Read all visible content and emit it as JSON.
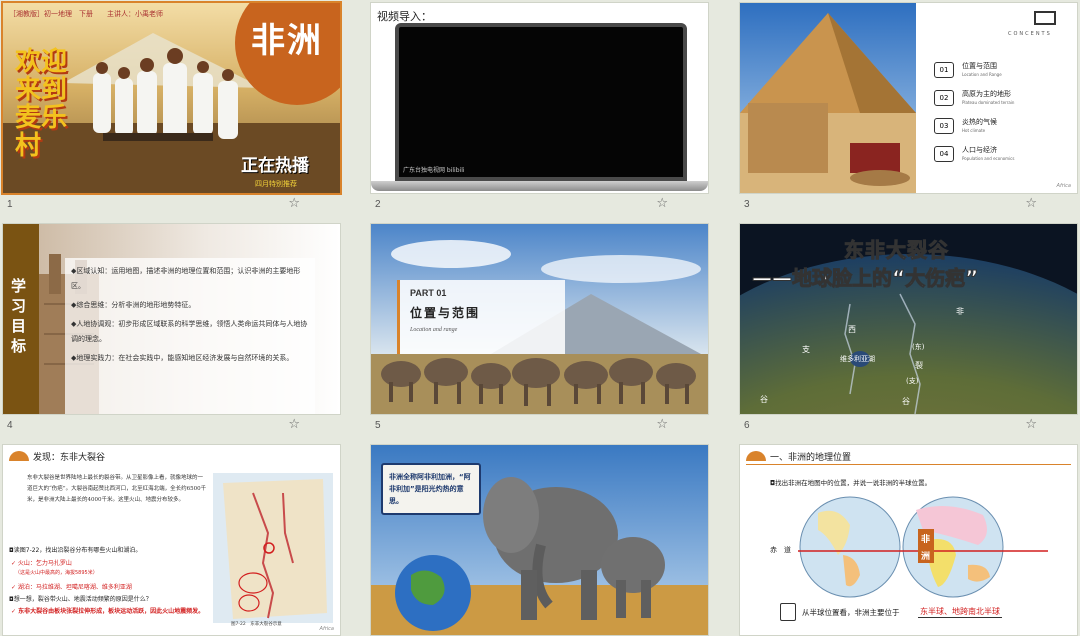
{
  "slides": [
    {
      "number": "1",
      "header": "［湘教版］初一地理　下册　　主讲人：小禹老师",
      "title_big": "非洲",
      "movie_title": "欢迎来到麦乐村",
      "badge": "正在热播",
      "bottom_text": "四月特别推荐"
    },
    {
      "number": "2",
      "label": "视频导入：",
      "watermark": "广东台独电视网 bilibili"
    },
    {
      "number": "3",
      "contents_word": "CONCENTS",
      "footer": "Africa",
      "items": [
        {
          "no": "01",
          "cn": "位置与范围",
          "en": "Location and Range"
        },
        {
          "no": "02",
          "cn": "高原为主的地形",
          "en": "Plateau dominated terrain"
        },
        {
          "no": "03",
          "cn": "炎热的气候",
          "en": "Hot climate"
        },
        {
          "no": "04",
          "cn": "人口与经济",
          "en": "Population and economics"
        }
      ]
    },
    {
      "number": "4",
      "side_title": "学习目标",
      "points": [
        "◆区域认知：运用地图，描述非洲的地理位置和范围；认识非洲的主要地形区。",
        "◆综合思维：分析非洲的地形地势特征。",
        "◆人地协调观：初步形成区域联系的科学思维，领悟人类命运共同体与人地协调的理念。",
        "◆地理实践力：在社会实践中，能感知地区经济发展与自然环境的关系。"
      ]
    },
    {
      "number": "5",
      "part": "PART 01",
      "title": "位置与范围",
      "subtitle": "Location and range"
    },
    {
      "number": "6",
      "title1": "东非大裂谷",
      "title2": "——地球脸上的“大伤疤”",
      "labels": [
        "西",
        "非",
        "支",
        "维多利亚湖",
        "(东)",
        "裂",
        "谷",
        "(支)",
        "谷"
      ]
    },
    {
      "number": "7",
      "heading": "发现：东非大裂谷",
      "para": "东非大裂谷是世界陆地上最长的裂谷带。从卫星影像上看，就像地球的一道巨大的“伤疤”。大裂谷南起赞比西河口，北至红海北端，全长约6500千米，是非洲大陆上最长的4000千米。这里火山、地震分布较多。",
      "q1": "◘读图7-22，找出沿裂谷分布有哪些火山和湖泊。",
      "a1": "✓ 火山：乞力马扎罗山",
      "a1b": "（这是火山中最高的，海拔5895米）",
      "a2": "✓ 湖泊：马拉维湖、坦噶尼喀湖、维多利亚湖",
      "q2": "◘想一想，裂谷带火山、地震活动频繁的原因是什么？",
      "a3": "✓ 东非大裂谷由板块张裂拉伸形成，板块运动活跃，因此火山地震频发。",
      "caption": "图7-22　东非大裂谷示意",
      "footer": "Africa"
    },
    {
      "number": "8",
      "banner": "非洲全称阿非利加洲，“阿非利加”是阳光灼热的意思。"
    },
    {
      "number": "9",
      "heading": "一、非洲的地理位置",
      "question": "◘找出非洲在地图中的位置，并说一说非洲的半球位置。",
      "equator": "赤　道",
      "map_label_1": "非",
      "map_label_2": "洲",
      "answer_prefix": "从半球位置看，非洲主要位于",
      "answer": "东半球、地跨南北半球"
    }
  ],
  "colors": {
    "orange": "#c8641e",
    "brown": "#7a5312",
    "red": "#d21f1f",
    "navy": "#1e3a6e"
  }
}
